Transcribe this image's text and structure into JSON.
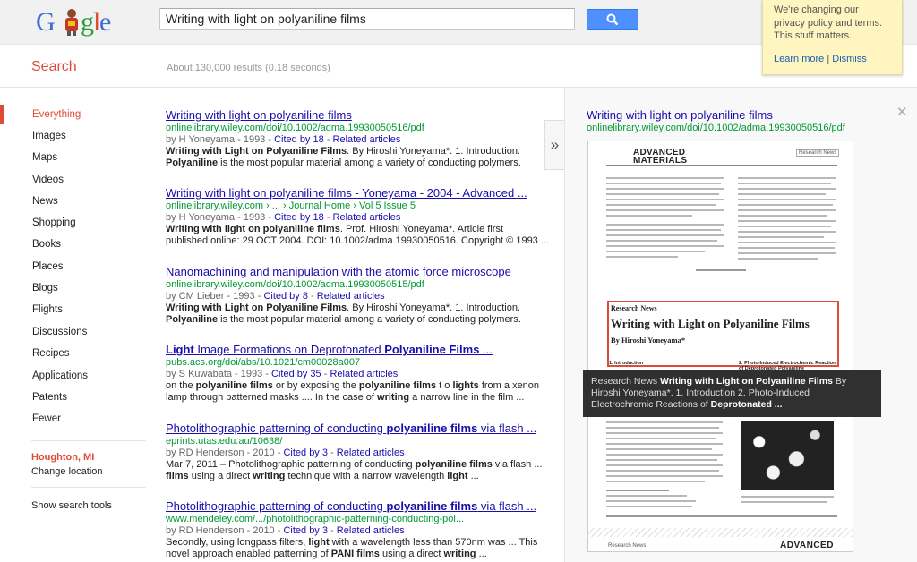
{
  "search": {
    "query": "Writing with light on polyaniline films"
  },
  "notice": {
    "text": "We're changing our privacy policy and terms. This stuff matters.",
    "learn_more": "Learn more",
    "separator": "|",
    "dismiss": "Dismiss"
  },
  "header": {
    "search_label": "Search",
    "stats": "About 130,000 results (0.18 seconds)"
  },
  "nav": {
    "items": [
      "Everything",
      "Images",
      "Maps",
      "Videos",
      "News",
      "Shopping",
      "Books",
      "Places",
      "Blogs",
      "Flights",
      "Discussions",
      "Recipes",
      "Applications",
      "Patents",
      "Fewer"
    ],
    "active": "Everything",
    "location": "Houghton, MI",
    "change_location": "Change location",
    "show_tools": "Show search tools"
  },
  "results": [
    {
      "title": "Writing with light on polyaniline films",
      "url": "onlinelibrary.wiley.com/doi/10.1002/adma.19930050516/pdf",
      "meta_prefix": "by H Yoneyama - 1993 - ",
      "cited": "Cited by 18",
      "meta_sep": " - ",
      "related": "Related articles",
      "snippet": [
        "Writing with Light on Polyaniline Films. By Hiroshi Yoneyama*. 1. Introduction.",
        "Polyaniline is the most popular material among a variety of conducting polymers."
      ]
    },
    {
      "title": "Writing with light on polyaniline films - Yoneyama - 2004 - Advanced ...",
      "url": "onlinelibrary.wiley.com › ... › Journal Home › Vol 5 Issue 5",
      "meta_prefix": "by H Yoneyama - 1993 - ",
      "cited": "Cited by 18",
      "meta_sep": " - ",
      "related": "Related articles",
      "snippet": [
        "Writing with light on polyaniline films. Prof. Hiroshi Yoneyama*. Article first",
        "published online: 29 OCT 2004. DOI: 10.1002/adma.19930050516. Copyright © 1993 ..."
      ]
    },
    {
      "title": "Nanomachining and manipulation with the atomic force microscope",
      "url": "onlinelibrary.wiley.com/doi/10.1002/adma.19930050515/pdf",
      "meta_prefix": "by CM Lieber - 1993 - ",
      "cited": "Cited by 8",
      "meta_sep": " - ",
      "related": "Related articles",
      "snippet": [
        "Writing with Light on Polyaniline Films. By Hiroshi Yoneyama*. 1. Introduction.",
        "Polyaniline is the most popular material among a variety of conducting polymers."
      ]
    },
    {
      "title": "Light Image Formations on Deprotonated Polyaniline Films ...",
      "url": "pubs.acs.org/doi/abs/10.1021/cm00028a007",
      "meta_prefix": "by S Kuwabata - 1993 - ",
      "cited": "Cited by 35",
      "meta_sep": " - ",
      "related": "Related articles",
      "snippet": [
        "on the polyaniline films or by exposing the polyaniline films t o lights from a xenon",
        "lamp through patterned masks .... In the case of writing a narrow line in the film ..."
      ]
    },
    {
      "title": "Photolithographic patterning of conducting polyaniline films via flash ...",
      "url": "eprints.utas.edu.au/10638/",
      "meta_prefix": "by RD Henderson - 2010 - ",
      "cited": "Cited by 3",
      "meta_sep": " - ",
      "related": "Related articles",
      "snippet": [
        "Mar 7, 2011 – Photolithographic patterning of conducting polyaniline films via flash ...",
        "films using a direct writing technique with a narrow wavelength light ..."
      ]
    },
    {
      "title": "Photolithographic patterning of conducting polyaniline films via flash ...",
      "url": "www.mendeley.com/.../photolithographic-patterning-conducting-pol...",
      "meta_prefix": "by RD Henderson - 2010 - ",
      "cited": "Cited by 3",
      "meta_sep": " - ",
      "related": "Related articles",
      "snippet": [
        "Secondly, using longpass filters, light with a wavelength less than 570nm was ... This",
        "novel approach enabled patterning of PANI films using a direct writing ..."
      ]
    }
  ],
  "preview": {
    "title": "Writing with light on polyaniline films",
    "url": "onlinelibrary.wiley.com/doi/10.1002/adma.19930050516/pdf",
    "journal": "ADVANCED MATERIALS",
    "section_tag": "Research News",
    "article_kicker": "Research News",
    "article_title": "Writing with Light on Polyaniline Films",
    "article_author": "By Hiroshi Yoneyama*",
    "intro_heading": "1. Introduction",
    "right_heading": "2. Photo-Induced Electrochemic Reaction of Deprotonated Polyaniline",
    "footer_left": "Research News",
    "footer_right": "ADVANCED",
    "tooltip": "Research News Writing with Light on Polyaniline Films By Hiroshi Yoneyama*. 1. Introduction 2. Photo-Induced Electrochromic Reactions of Deprotonated ..."
  },
  "logo": {
    "letters": [
      "G",
      "o",
      "g",
      "l",
      "e"
    ]
  }
}
